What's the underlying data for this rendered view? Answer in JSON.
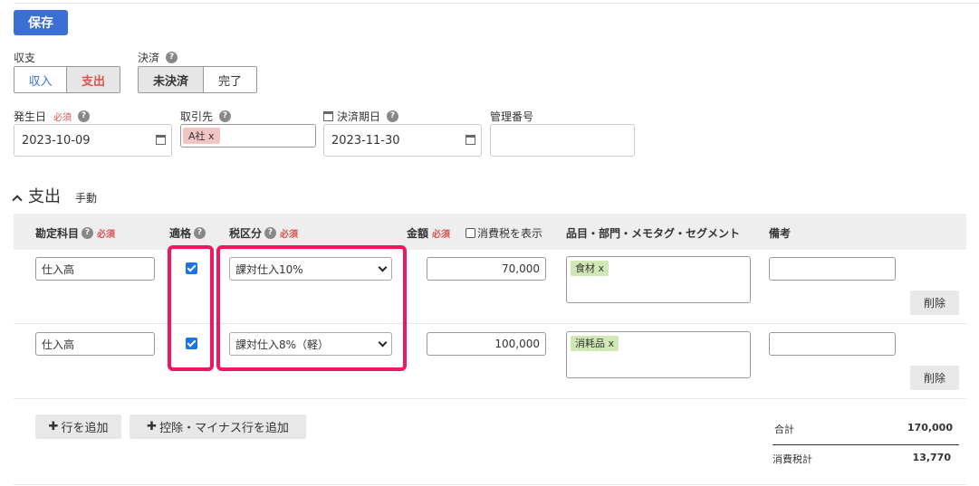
{
  "toolbar": {
    "save_label": "保存"
  },
  "income_expense": {
    "label": "収支",
    "options": [
      "収入",
      "支出"
    ],
    "selected": "支出"
  },
  "settlement": {
    "label": "決済",
    "options": [
      "未決済",
      "完了"
    ],
    "selected": "未決済"
  },
  "fields": {
    "issue_date": {
      "label": "発生日",
      "required": "必須",
      "value": "2023-10-09"
    },
    "partner": {
      "label": "取引先",
      "tag": "A社 x"
    },
    "due_date": {
      "label": "決済期日",
      "value": "2023-11-30"
    },
    "management_no": {
      "label": "管理番号",
      "value": ""
    }
  },
  "section": {
    "title": "支出",
    "mode": "手動"
  },
  "table": {
    "headers": {
      "account": "勘定科目",
      "account_req": "必須",
      "qualified": "適格",
      "tax": "税区分",
      "tax_req": "必須",
      "amount": "金額",
      "amount_req": "必須",
      "show_tax": "消費税を表示",
      "item": "品目・部門・メモタグ・セグメント",
      "note": "備考"
    },
    "rows": [
      {
        "account": "仕入高",
        "qualified": true,
        "tax": "課対仕入10%",
        "amount": "70,000",
        "tag": "食材 x",
        "note": "",
        "delete": "削除"
      },
      {
        "account": "仕入高",
        "qualified": true,
        "tax": "課対仕入8%（軽）",
        "amount": "100,000",
        "tag": "消耗品 x",
        "note": "",
        "delete": "削除"
      }
    ]
  },
  "actions": {
    "add_row": "行を追加",
    "add_deduction": "控除・マイナス行を追加"
  },
  "summary": {
    "total_label": "合計",
    "total": "170,000",
    "tax_label": "消費税計",
    "tax": "13,770"
  },
  "colors": {
    "accent": "#3b6fd4",
    "highlight": "#f0185c",
    "required": "#d9534f"
  }
}
